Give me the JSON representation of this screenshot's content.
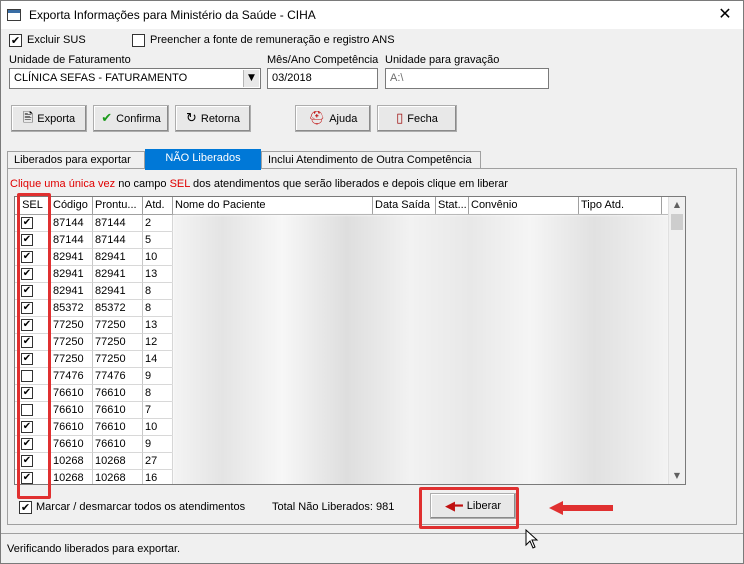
{
  "window": {
    "title": "Exporta Informações para Ministério da Saúde - CIHA",
    "close": "✕"
  },
  "options": {
    "excluir_sus": {
      "label": "Excluir SUS",
      "checked": true
    },
    "preencher": {
      "label": "Preencher a fonte de remuneração e registro ANS",
      "checked": false
    }
  },
  "fields": {
    "unidade_faturamento": {
      "label": "Unidade de Faturamento",
      "value": "CLÍNICA SEFAS - FATURAMENTO"
    },
    "mes_ano": {
      "label": "Mês/Ano Competência",
      "value": "03/2018"
    },
    "unidade_gravacao": {
      "label": "Unidade para gravação",
      "value": "A:\\"
    }
  },
  "toolbar": {
    "exporta": "Exporta",
    "confirma": "Confirma",
    "retorna": "Retorna",
    "ajuda": "Ajuda",
    "fecha": "Fecha"
  },
  "tabs": [
    "Liberados para exportar",
    "NÃO Liberados",
    "Inclui Atendimento de Outra Competência"
  ],
  "hint": {
    "part1": "Clique uma única vez",
    "part2": " no campo ",
    "part3": "SEL",
    "part4": " dos atendimentos que serão liberados e depois clique em liberar"
  },
  "grid": {
    "columns": [
      "SEL",
      "Código",
      "Prontu...",
      "Atd.",
      "Nome do Paciente",
      "Data Saída",
      "Stat...",
      "Convênio",
      "Tipo Atd."
    ],
    "rows": [
      {
        "sel": true,
        "codigo": "87144",
        "prontuario": "87144",
        "atd": "2"
      },
      {
        "sel": true,
        "codigo": "87144",
        "prontuario": "87144",
        "atd": "5"
      },
      {
        "sel": true,
        "codigo": "82941",
        "prontuario": "82941",
        "atd": "10"
      },
      {
        "sel": true,
        "codigo": "82941",
        "prontuario": "82941",
        "atd": "13"
      },
      {
        "sel": true,
        "codigo": "82941",
        "prontuario": "82941",
        "atd": "8"
      },
      {
        "sel": true,
        "codigo": "85372",
        "prontuario": "85372",
        "atd": "8"
      },
      {
        "sel": true,
        "codigo": "77250",
        "prontuario": "77250",
        "atd": "13"
      },
      {
        "sel": true,
        "codigo": "77250",
        "prontuario": "77250",
        "atd": "12"
      },
      {
        "sel": true,
        "codigo": "77250",
        "prontuario": "77250",
        "atd": "14"
      },
      {
        "sel": false,
        "codigo": "77476",
        "prontuario": "77476",
        "atd": "9"
      },
      {
        "sel": true,
        "codigo": "76610",
        "prontuario": "76610",
        "atd": "8"
      },
      {
        "sel": false,
        "codigo": "76610",
        "prontuario": "76610",
        "atd": "7"
      },
      {
        "sel": true,
        "codigo": "76610",
        "prontuario": "76610",
        "atd": "10"
      },
      {
        "sel": true,
        "codigo": "76610",
        "prontuario": "76610",
        "atd": "9"
      },
      {
        "sel": true,
        "codigo": "10268",
        "prontuario": "10268",
        "atd": "27"
      },
      {
        "sel": true,
        "codigo": "10268",
        "prontuario": "10268",
        "atd": "16"
      }
    ]
  },
  "footer": {
    "marcar_label": "Marcar / desmarcar todos os atendimentos",
    "marcar_checked": true,
    "total": "Total Não Liberados: 981",
    "liberar": "Liberar"
  },
  "status": "Verificando liberados para exportar.",
  "colors": {
    "accent": "#0078d7",
    "highlight": "#e03030",
    "hint_red": "#e00000"
  },
  "icons": [
    "app-window-icon",
    "close-icon",
    "export-icon",
    "check-icon",
    "refresh-icon",
    "help-icon",
    "door-icon",
    "arrow-left-icon",
    "scroll-up-icon",
    "scroll-down-icon",
    "mouse-cursor-icon"
  ]
}
